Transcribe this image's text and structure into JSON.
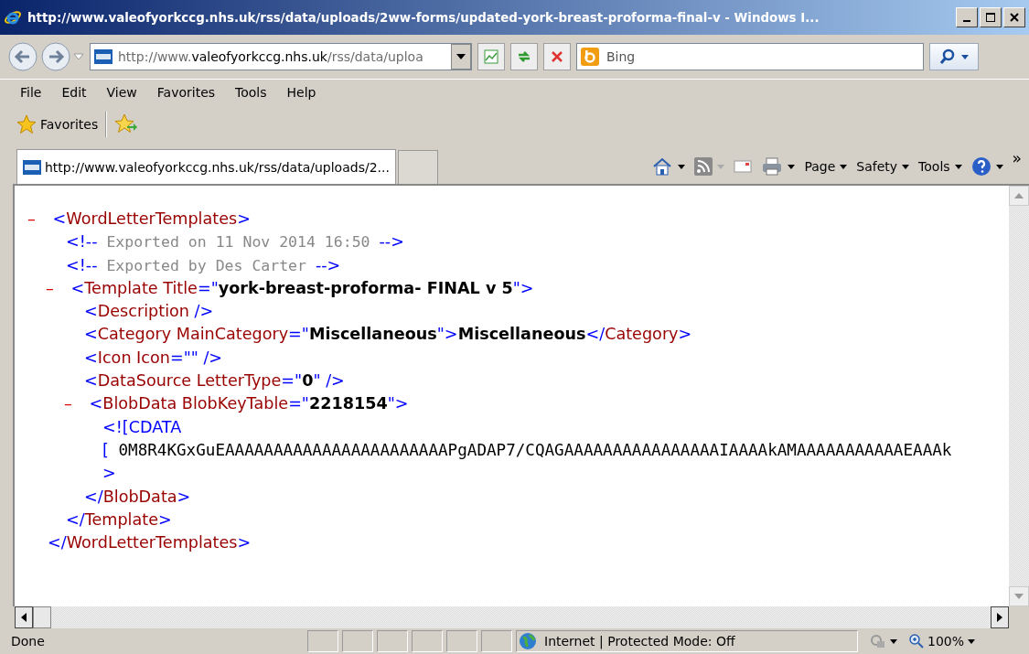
{
  "window": {
    "title": "http://www.valeofyorkccg.nhs.uk/rss/data/uploads/2ww-forms/updated-york-breast-proforma-final-v - Windows I..."
  },
  "address": {
    "prefix": "http://www.",
    "domain": "valeofyorkccg.nhs.uk",
    "rest": "/rss/data/uploa"
  },
  "search": {
    "placeholder": "Bing"
  },
  "menu": [
    "File",
    "Edit",
    "View",
    "Favorites",
    "Tools",
    "Help"
  ],
  "favorites_bar": {
    "label": "Favorites"
  },
  "tabs": [
    {
      "label": "http://www.valeofyorkccg.nhs.uk/rss/data/uploads/2...",
      "selected": true
    }
  ],
  "command_bar": [
    {
      "kind": "home"
    },
    {
      "kind": "feeds"
    },
    {
      "kind": "mail"
    },
    {
      "kind": "print"
    },
    {
      "kind": "menu",
      "label": "Page"
    },
    {
      "kind": "menu",
      "label": "Safety"
    },
    {
      "kind": "menu",
      "label": "Tools"
    },
    {
      "kind": "help"
    }
  ],
  "command_overflow": "»",
  "xml": [
    {
      "kind": "element",
      "expanded": true,
      "toggle": "–",
      "parts": [
        {
          "kind": "bracket",
          "text": "<"
        },
        {
          "kind": "tag",
          "text": "WordLetterTemplates"
        },
        {
          "kind": "bracket",
          "text": ">"
        }
      ],
      "children": [
        {
          "kind": "leaf",
          "parts": [
            {
              "kind": "bracket",
              "text": "<!--"
            },
            {
              "kind": "comment",
              "text": " Exported on 11 Nov 2014 16:50 "
            },
            {
              "kind": "bracket",
              "text": "-->"
            }
          ]
        },
        {
          "kind": "leaf",
          "parts": [
            {
              "kind": "bracket",
              "text": "<!--"
            },
            {
              "kind": "comment",
              "text": " Exported by Des Carter "
            },
            {
              "kind": "bracket",
              "text": "-->"
            }
          ]
        },
        {
          "kind": "element",
          "expanded": true,
          "toggle": "–",
          "parts": [
            {
              "kind": "bracket",
              "text": "<"
            },
            {
              "kind": "tag",
              "text": "Template Title"
            },
            {
              "kind": "bracket",
              "text": "=\""
            },
            {
              "kind": "value",
              "text": "york-breast-proforma- FINAL v 5"
            },
            {
              "kind": "bracket",
              "text": "\">"
            }
          ],
          "children": [
            {
              "kind": "leaf",
              "parts": [
                {
                  "kind": "bracket",
                  "text": "<"
                },
                {
                  "kind": "tag",
                  "text": "Description"
                },
                {
                  "kind": "bracket",
                  "text": " />"
                }
              ]
            },
            {
              "kind": "leaf",
              "parts": [
                {
                  "kind": "bracket",
                  "text": "<"
                },
                {
                  "kind": "tag",
                  "text": "Category MainCategory"
                },
                {
                  "kind": "bracket",
                  "text": "=\""
                },
                {
                  "kind": "value",
                  "text": "Miscellaneous"
                },
                {
                  "kind": "bracket",
                  "text": "\">"
                },
                {
                  "kind": "value",
                  "text": "Miscellaneous"
                },
                {
                  "kind": "bracket",
                  "text": "</"
                },
                {
                  "kind": "tag",
                  "text": "Category"
                },
                {
                  "kind": "bracket",
                  "text": ">"
                }
              ]
            },
            {
              "kind": "leaf",
              "parts": [
                {
                  "kind": "bracket",
                  "text": "<"
                },
                {
                  "kind": "tag",
                  "text": "Icon Icon"
                },
                {
                  "kind": "bracket",
                  "text": "=\"\" />"
                }
              ]
            },
            {
              "kind": "leaf",
              "parts": [
                {
                  "kind": "bracket",
                  "text": "<"
                },
                {
                  "kind": "tag",
                  "text": "DataSource LetterType"
                },
                {
                  "kind": "bracket",
                  "text": "=\""
                },
                {
                  "kind": "value",
                  "text": "0"
                },
                {
                  "kind": "bracket",
                  "text": "\" />"
                }
              ]
            },
            {
              "kind": "element",
              "expanded": true,
              "toggle": "–",
              "parts": [
                {
                  "kind": "bracket",
                  "text": "<"
                },
                {
                  "kind": "tag",
                  "text": "BlobData BlobKeyTable"
                },
                {
                  "kind": "bracket",
                  "text": "=\""
                },
                {
                  "kind": "value",
                  "text": "2218154"
                },
                {
                  "kind": "bracket",
                  "text": "\">"
                }
              ],
              "children": [
                {
                  "kind": "leaf",
                  "parts": [
                    {
                      "kind": "bracket",
                      "text": "<![CDATA"
                    }
                  ]
                },
                {
                  "kind": "leaf",
                  "parts": [
                    {
                      "kind": "bracket",
                      "text": "["
                    },
                    {
                      "kind": "cdata",
                      "text": " 0M8R4KGxGuEAAAAAAAAAAAAAAAAAAAAAAAPgADAP7/CQAGAAAAAAAAAAAAAAAAIAAAAkAMAAAAAAAAAAAEAAAk"
                    }
                  ]
                },
                {
                  "kind": "leaf",
                  "parts": [
                    {
                      "kind": "bracket",
                      "text": ">"
                    }
                  ]
                }
              ],
              "close": [
                {
                  "kind": "bracket",
                  "text": "</"
                },
                {
                  "kind": "tag",
                  "text": "BlobData"
                },
                {
                  "kind": "bracket",
                  "text": ">"
                }
              ]
            }
          ],
          "close": [
            {
              "kind": "bracket",
              "text": "</"
            },
            {
              "kind": "tag",
              "text": "Template"
            },
            {
              "kind": "bracket",
              "text": ">"
            }
          ]
        }
      ],
      "close": [
        {
          "kind": "bracket",
          "text": "</"
        },
        {
          "kind": "tag",
          "text": "WordLetterTemplates"
        },
        {
          "kind": "bracket",
          "text": ">"
        }
      ]
    }
  ],
  "status_bar": {
    "text": "Done",
    "zone": "Internet | Protected Mode: Off",
    "zoom": "100%"
  }
}
